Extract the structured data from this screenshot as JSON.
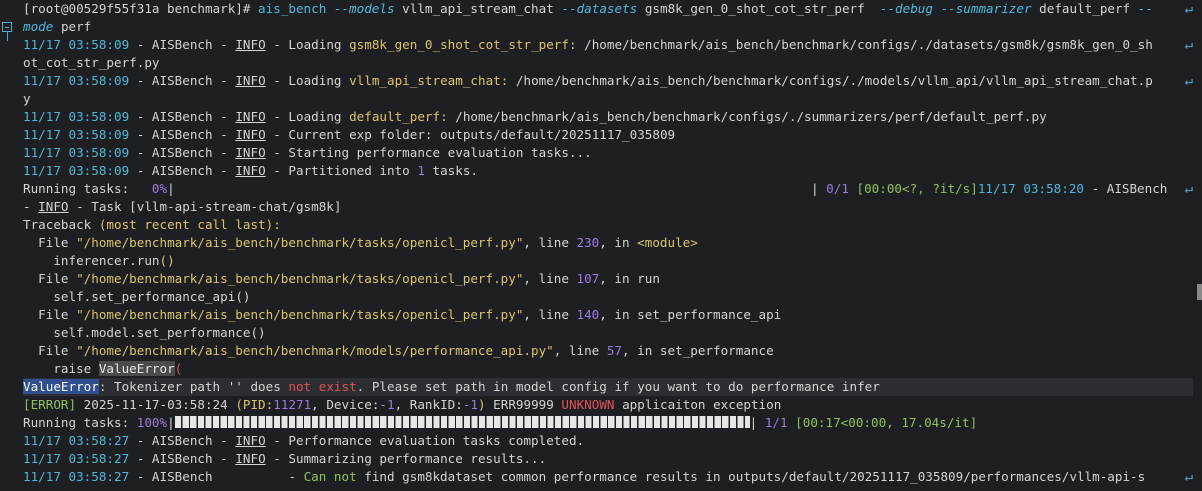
{
  "prompt": {
    "user_host": "[root@00529f55f31a benchmark]# ",
    "command": "ais_bench",
    "flag_models": "--models",
    "models_value": "vllm_api_stream_chat",
    "flag_datasets": "--datasets",
    "datasets_value": "gsm8k_gen_0_shot_cot_str_perf",
    "flag_debug": "--debug",
    "flag_summarizer": "--summarizer",
    "summarizer_value": "default_perf",
    "flag_mode_start": "--",
    "flag_mode_end": "mode",
    "mode_value": "perf"
  },
  "common": {
    "app": "AISBench",
    "info": "INFO",
    "sep": " - "
  },
  "log": [
    {
      "ts": "11/17 03:58:09",
      "pre": "Loading ",
      "hl": "gsm8k_gen_0_shot_cot_str_perf:",
      "post": " /home/benchmark/ais_bench/benchmark/configs/./datasets/gsm8k/gsm8k_gen_0_sh",
      "cont": "ot_cot_str_perf.py"
    },
    {
      "ts": "11/17 03:58:09",
      "pre": "Loading ",
      "hl": "vllm_api_stream_chat:",
      "post": " /home/benchmark/ais_bench/benchmark/configs/./models/vllm_api/vllm_api_stream_chat.p",
      "cont": "y"
    },
    {
      "ts": "11/17 03:58:09",
      "pre": "Loading ",
      "hl": "default_perf:",
      "post": " /home/benchmark/ais_bench/benchmark/configs/./summarizers/perf/default_perf.py"
    },
    {
      "ts": "11/17 03:58:09",
      "pre": "Current exp folder:",
      "post": " outputs/default/20251117_035809"
    },
    {
      "ts": "11/17 03:58:09",
      "pre": "Starting performance evaluation tasks..."
    },
    {
      "ts": "11/17 03:58:09",
      "pre": "Partitioned into ",
      "n": "1",
      "post": " tasks."
    }
  ],
  "running1": {
    "label": "Running tasks:   ",
    "pct": "0%",
    "bar": "|",
    "right_bar": "| ",
    "count": "0/1",
    "timing": " [00:00<?, ?it/s]",
    "ts": "11/17 03:58:20",
    "app": " - AISBench ",
    "cont_dash": "- ",
    "info": "INFO",
    "cont_rest": " - Task [vllm-api-stream-chat/gsm8k]"
  },
  "traceback": {
    "header_a": "Traceback ",
    "header_b": "(most recent call last):",
    "frames": [
      {
        "pre": "  File ",
        "path": "\"/home/benchmark/ais_bench/benchmark/tasks/openicl_perf.py\"",
        "mid": ", line ",
        "line": "230",
        "post": ", in ",
        "fn": "<module>",
        "code_a": "    inferencer.run",
        "code_b": "()"
      },
      {
        "pre": "  File ",
        "path": "\"/home/benchmark/ais_bench/benchmark/tasks/openicl_perf.py\"",
        "mid": ", line ",
        "line": "107",
        "post": ", in ",
        "fn": "run",
        "code_a": "    self.set_performance_api",
        "code_b": "()"
      },
      {
        "pre": "  File ",
        "path": "\"/home/benchmark/ais_bench/benchmark/tasks/openicl_perf.py\"",
        "mid": ", line ",
        "line": "140",
        "post": ", in ",
        "fn": "set_performance_api",
        "code_a": "    self.model.set_performance",
        "code_b": "()"
      },
      {
        "pre": "  File ",
        "path": "\"/home/benchmark/ais_bench/benchmark/models/performance_api.py\"",
        "mid": ", line ",
        "line": "57",
        "post": ", in ",
        "fn": "set_performance",
        "code_a": "    raise ",
        "code_b": "ValueError",
        "code_c": "("
      }
    ]
  },
  "value_error": {
    "name": "ValueError",
    "text_a": ": Tokenizer path '' does ",
    "not_word": "not",
    "text_b": " ",
    "exist_word": "exist",
    "text_c": ". Please set path in model config if you want to do performance infer"
  },
  "error_line": {
    "tag": "[ERROR]",
    "ts": " 2025-11-17-03:58:24 ",
    "pid_a": "(PID:",
    "pid_num": "11271",
    "pid_b": ", Device:",
    "device": "-1",
    "pid_c": ", RankID:",
    "rank": "-1",
    "pid_d": ")",
    "code": " ERR99999 ",
    "unknown": "UNKNOWN",
    "msg": " applicaiton exception"
  },
  "running2": {
    "label": "Running tasks: ",
    "pct": "100%",
    "progress": 1.0,
    "sep": "| ",
    "count": "1/1",
    "timing": " [00:17<00:00, 17.04s/it]"
  },
  "log_end": [
    {
      "ts": "11/17 03:58:27",
      "info": true,
      "msg": "Performance evaluation tasks completed."
    },
    {
      "ts": "11/17 03:58:27",
      "info": true,
      "msg": "Summarizing performance results..."
    },
    {
      "ts": "11/17 03:58:27",
      "info": false,
      "gap": "          ",
      "msg_a": "- ",
      "msg_b": "Can not",
      "msg_c": " find gsm8kdataset common performance results in outputs/default/20251117_035809/performances/vllm-api-s"
    }
  ],
  "icons": {
    "wrap": "wrap-arrow-icon",
    "fold": "fold-collapse-icon"
  }
}
